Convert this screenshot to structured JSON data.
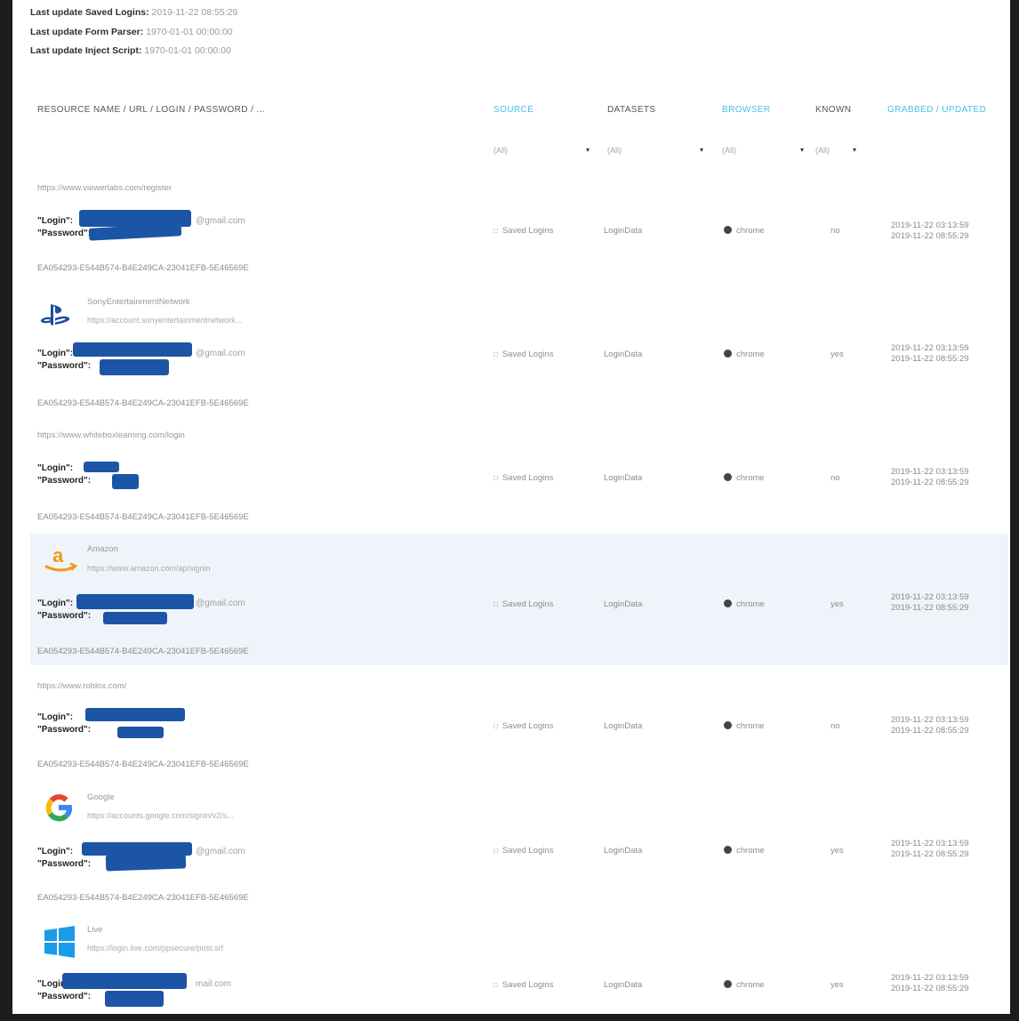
{
  "last_updates": [
    {
      "label": "Last update Saved Logins:",
      "value": "2019-11-22 08:55:29"
    },
    {
      "label": "Last update Form Parser:",
      "value": "1970-01-01 00:00:00"
    },
    {
      "label": "Last update Inject Script:",
      "value": "1970-01-01 00:00:00"
    }
  ],
  "columns": {
    "resource": "RESOURCE NAME / URL / LOGIN / PASSWORD / ...",
    "source": "SOURCE",
    "datasets": "DATASETS",
    "browser": "BROWSER",
    "known": "KNOWN",
    "grabbed": "GRABBED",
    "sep": "/",
    "updated": "UPDATED"
  },
  "filters": {
    "source": "(All)",
    "datasets": "(All)",
    "browser": "(All)",
    "known": "(All)"
  },
  "labels": {
    "login": "\"Login\":",
    "password": "\"Password\":"
  },
  "icons": {
    "playstation": "playstation-logo-icon",
    "amazon": "amazon-logo-icon",
    "google": "google-logo-icon",
    "windows": "windows-logo-icon",
    "source": "database-icon",
    "browser": "chrome-icon"
  },
  "colors": {
    "link": "#48c0e6",
    "redaction": "#1d55a6",
    "highlight": "#eef4fa"
  },
  "rows": [
    {
      "url": "https://www.viewerlabs.com/register",
      "name": "",
      "login_suffix": "@gmail.com",
      "source": "Saved Logins",
      "dataset": "LoginData",
      "browser": "chrome",
      "known": "no",
      "grabbed": "2019-11-22 03:13:59",
      "updated": "2019-11-22 08:55:29",
      "hash": "EA054293-E544B574-B4E249CA-23041EFB-5E46569E"
    },
    {
      "url": "https://account.sonyentertainmentnetwork...",
      "name": "SonyEntertainmentNetwork",
      "login_suffix": "@gmail.com",
      "source": "Saved Logins",
      "dataset": "LoginData",
      "browser": "chrome",
      "known": "yes",
      "grabbed": "2019-11-22 03:13:59",
      "updated": "2019-11-22 08:55:29",
      "hash": "EA054293-E544B574-B4E249CA-23041EFB-5E46569E"
    },
    {
      "url": "https://www.whiteboxlearning.com/login",
      "name": "",
      "login_suffix": "",
      "source": "Saved Logins",
      "dataset": "LoginData",
      "browser": "chrome",
      "known": "no",
      "grabbed": "2019-11-22 03:13:59",
      "updated": "2019-11-22 08:55:29",
      "hash": "EA054293-E544B574-B4E249CA-23041EFB-5E46569E"
    },
    {
      "url": "https://www.amazon.com/ap/signin",
      "name": "Amazon",
      "login_suffix": "@gmail.com",
      "source": "Saved Logins",
      "dataset": "LoginData",
      "browser": "chrome",
      "known": "yes",
      "grabbed": "2019-11-22 03:13:59",
      "updated": "2019-11-22 08:55:29",
      "hash": "EA054293-E544B574-B4E249CA-23041EFB-5E46569E"
    },
    {
      "url": "https://www.roblox.com/",
      "name": "",
      "login_suffix": "",
      "source": "Saved Logins",
      "dataset": "LoginData",
      "browser": "chrome",
      "known": "no",
      "grabbed": "2019-11-22 03:13:59",
      "updated": "2019-11-22 08:55:29",
      "hash": "EA054293-E544B574-B4E249CA-23041EFB-5E46569E"
    },
    {
      "url": "https://accounts.google.com/signin/v2/s...",
      "name": "Google",
      "login_suffix": "@gmail.com",
      "source": "Saved Logins",
      "dataset": "LoginData",
      "browser": "chrome",
      "known": "yes",
      "grabbed": "2019-11-22 03:13:59",
      "updated": "2019-11-22 08:55:29",
      "hash": "EA054293-E544B574-B4E249CA-23041EFB-5E46569E"
    },
    {
      "url": "https://login.live.com/ppsecure/post.srf",
      "name": "Live",
      "login_suffix": "mail.com",
      "source": "Saved Logins",
      "dataset": "LoginData",
      "browser": "chrome",
      "known": "yes",
      "grabbed": "2019-11-22 03:13:59",
      "updated": "2019-11-22 08:55:29",
      "hash": ""
    }
  ]
}
